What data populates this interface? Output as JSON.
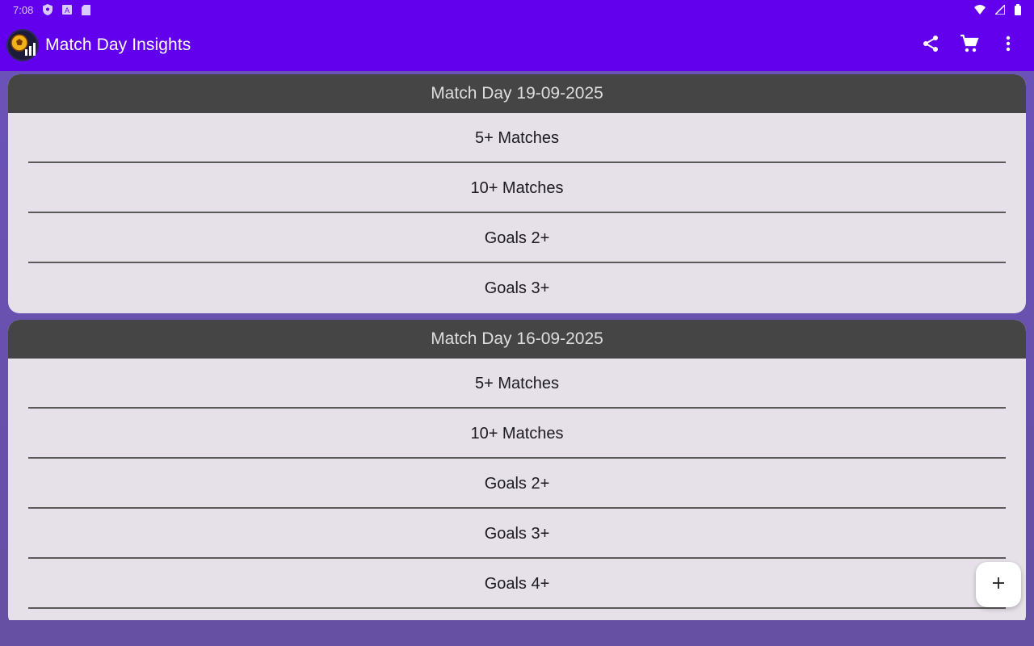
{
  "statusbar": {
    "time": "7:08",
    "icons_left": [
      "shield-icon",
      "translate-icon",
      "sd-card-icon"
    ],
    "icons_right": [
      "wifi-icon",
      "signal-icon",
      "battery-icon"
    ]
  },
  "appbar": {
    "title": "Match Day Insights",
    "actions": [
      "share-icon",
      "cart-icon",
      "more-vert-icon"
    ]
  },
  "cards": [
    {
      "header": "Match Day 19-09-2025",
      "items": [
        "5+ Matches",
        "10+ Matches",
        "Goals 2+",
        "Goals 3+"
      ]
    },
    {
      "header": "Match Day 16-09-2025",
      "items": [
        "5+ Matches",
        "10+ Matches",
        "Goals 2+",
        "Goals 3+",
        "Goals 4+"
      ]
    }
  ],
  "fab": {
    "icon": "add-icon"
  },
  "colors": {
    "appbar": "#6200ee",
    "background": "#6650a4",
    "card": "#e6e0e9",
    "card_header": "#454545"
  }
}
